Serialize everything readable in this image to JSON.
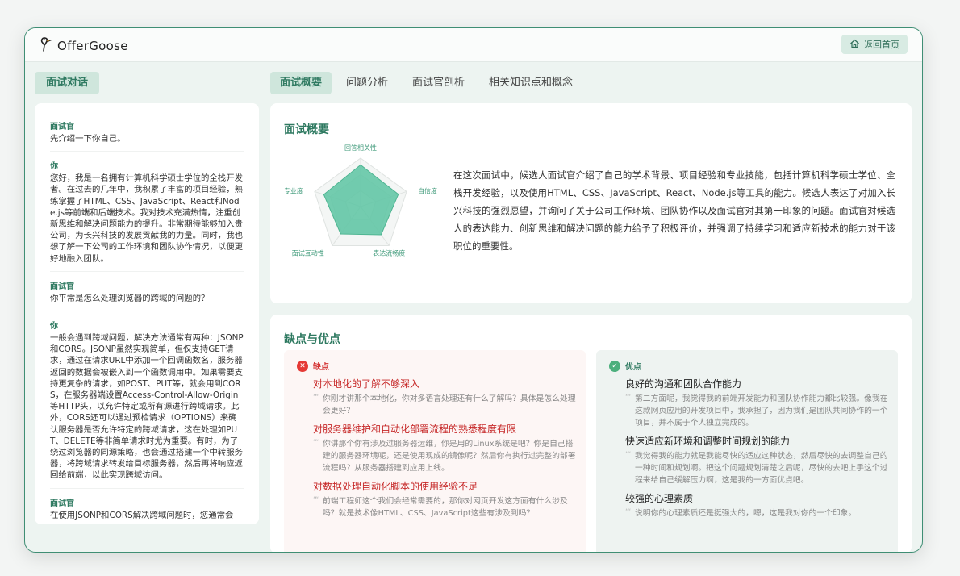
{
  "app": {
    "logo_text": "OfferGoose",
    "home_button": "返回首页"
  },
  "left_tab": "面试对话",
  "tabs": [
    "面试概要",
    "问题分析",
    "面试官剖析",
    "相关知识点和概念"
  ],
  "chat": [
    {
      "role": "面试官",
      "text": "先介绍一下你自己。"
    },
    {
      "role": "你",
      "text": "您好，我是一名拥有计算机科学硕士学位的全栈开发者。在过去的几年中，我积累了丰富的项目经验，熟练掌握了HTML、CSS、JavaScript、React和Node.js等前端和后端技术。我对技术充满热情，注重创新思维和解决问题能力的提升。非常期待能够加入贵公司，为长兴科技的发展贡献我的力量。同时，我也想了解一下公司的工作环境和团队协作情况，以便更好地融入团队。"
    },
    {
      "role": "面试官",
      "text": "你平常是怎么处理浏览器的跨域的问题的？"
    },
    {
      "role": "你",
      "text": "一般会遇到跨域问题，解决方法通常有两种：JSONP和CORS。JSONP虽然实现简单，但仅支持GET请求，通过在请求URL中添加一个回调函数名，服务器返回的数据会被嵌入到一个函数调用中。如果需要支持更复杂的请求，如POST、PUT等，就会用到CORS，在服务器端设置Access-Control-Allow-Origin等HTTP头，以允许特定或所有源进行跨域请求。此外，CORS还可以通过预检请求（OPTIONS）来确认服务器是否允许特定的跨域请求，这在处理如PUT、DELETE等非简单请求时尤为重要。有时，为了绕过浏览器的同源策略，也会通过搭建一个中转服务器，将跨域请求转发给目标服务器，然后再将响应返回给前端，以此实现跨域访问。"
    },
    {
      "role": "面试官",
      "text": "在使用JSONP和CORS解决跨域问题时，您通常会"
    }
  ],
  "overview": {
    "title": "面试概要",
    "radar_labels": [
      "回答相关性",
      "自信度",
      "表达流畅度",
      "面试互动性",
      "专业度"
    ],
    "radar_values": [
      0.86,
      0.82,
      0.72,
      0.7,
      0.8
    ],
    "summary": "在这次面试中，候选人面试官介绍了自己的学术背景、项目经验和专业技能，包括计算机科学硕士学位、全栈开发经验，以及使用HTML、CSS、JavaScript、React、Node.js等工具的能力。候选人表达了对加入长兴科技的强烈愿望，并询问了关于公司工作环境、团队协作以及面试官对其第一印象的问题。面试官对候选人的表达能力、创新思维和解决问题的能力给予了积极评价，并强调了持续学习和适应新技术的能力对于该职位的重要性。"
  },
  "pros_cons": {
    "title": "缺点与优点",
    "cons_label": "缺点",
    "pros_label": "优点",
    "cons": [
      {
        "title": "对本地化的了解不够深入",
        "quote": "你刚才讲那个本地化，你对多语言处理还有什么了解吗？具体是怎么处理会更好？"
      },
      {
        "title": "对服务器维护和自动化部署流程的熟悉程度有限",
        "quote": "你讲那个你有涉及过服务器运维，你是用的Linux系统是吧？你是自己搭建的服务器环境呢，还是使用现成的镜像呢？然后你有执行过完整的部署流程吗？从服务器搭建到应用上线。"
      },
      {
        "title": "对数据处理自动化脚本的使用经验不足",
        "quote": "前端工程师这个我们会经常需要的，那你对网页开发这方面有什么涉及吗？就是技术像HTML、CSS、JavaScript这些有涉及到吗？"
      }
    ],
    "pros": [
      {
        "title": "良好的沟通和团队合作能力",
        "quote": "第二方面呢，我觉得我的前端开发能力和团队协作能力都比较强。像我在这款网页应用的开发项目中，我承担了，因为我们是团队共同协作的一个项目，并不属于个人独立完成的。"
      },
      {
        "title": "快速适应新环境和调整时间规划的能力",
        "quote": "我觉得我的能力就是我能尽快的适应这种状态，然后尽快的去调整自己的一种时间和规划啊。把这个问题规划清楚之后呢，尽快的去吧上手这个过程来给自己缓解压力啊，这是我的一方面优点吧。"
      },
      {
        "title": "较强的心理素质",
        "quote": "说明你的心理素质还是挺强大的，嗯，这是我对你的一个印象。"
      }
    ]
  },
  "colors": {
    "accent": "#2f7a61",
    "radar_fill": "#5cc4a2",
    "cons": "#c62828",
    "pros_badge": "#4caf7d"
  }
}
